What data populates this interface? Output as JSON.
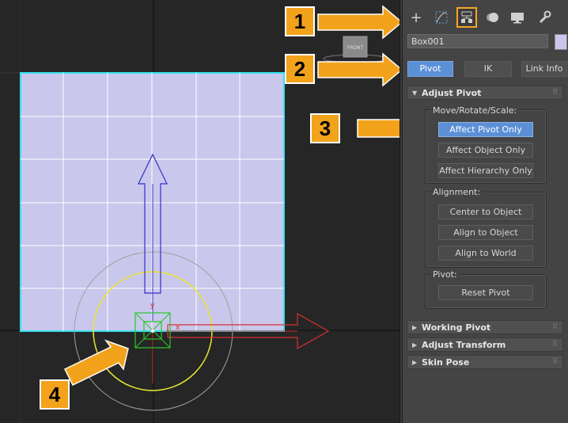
{
  "viewport": {
    "cube_label": "FRONT",
    "axis_labels": {
      "x": "x",
      "y": "y"
    }
  },
  "toolbar": {
    "icons": [
      "create-icon",
      "modify-icon",
      "hierarchy-icon",
      "motion-icon",
      "display-icon",
      "utilities-icon"
    ],
    "active": "hierarchy-icon"
  },
  "object": {
    "name": "Box001",
    "color": "#c9c7ec"
  },
  "tabs": [
    {
      "label": "Pivot",
      "active": true
    },
    {
      "label": "IK",
      "active": false
    },
    {
      "label": "Link Info",
      "active": false
    }
  ],
  "adjust_pivot": {
    "title": "Adjust Pivot",
    "move_group": {
      "label": "Move/Rotate/Scale:",
      "buttons": [
        "Affect Pivot Only",
        "Affect Object Only",
        "Affect Hierarchy Only"
      ]
    },
    "alignment_group": {
      "label": "Alignment:",
      "buttons": [
        "Center to Object",
        "Align to Object",
        "Align to World"
      ]
    },
    "pivot_group": {
      "label": "Pivot:",
      "buttons": [
        "Reset Pivot"
      ]
    }
  },
  "rollouts": [
    "Working Pivot",
    "Adjust Transform",
    "Skin Pose"
  ],
  "callouts": [
    "1",
    "2",
    "3",
    "4"
  ],
  "colors": {
    "accent": "#f2a21b",
    "selected": "#5b8fd6",
    "box_fill": "#c9c7ec",
    "box_outline": "#33e0ee"
  }
}
